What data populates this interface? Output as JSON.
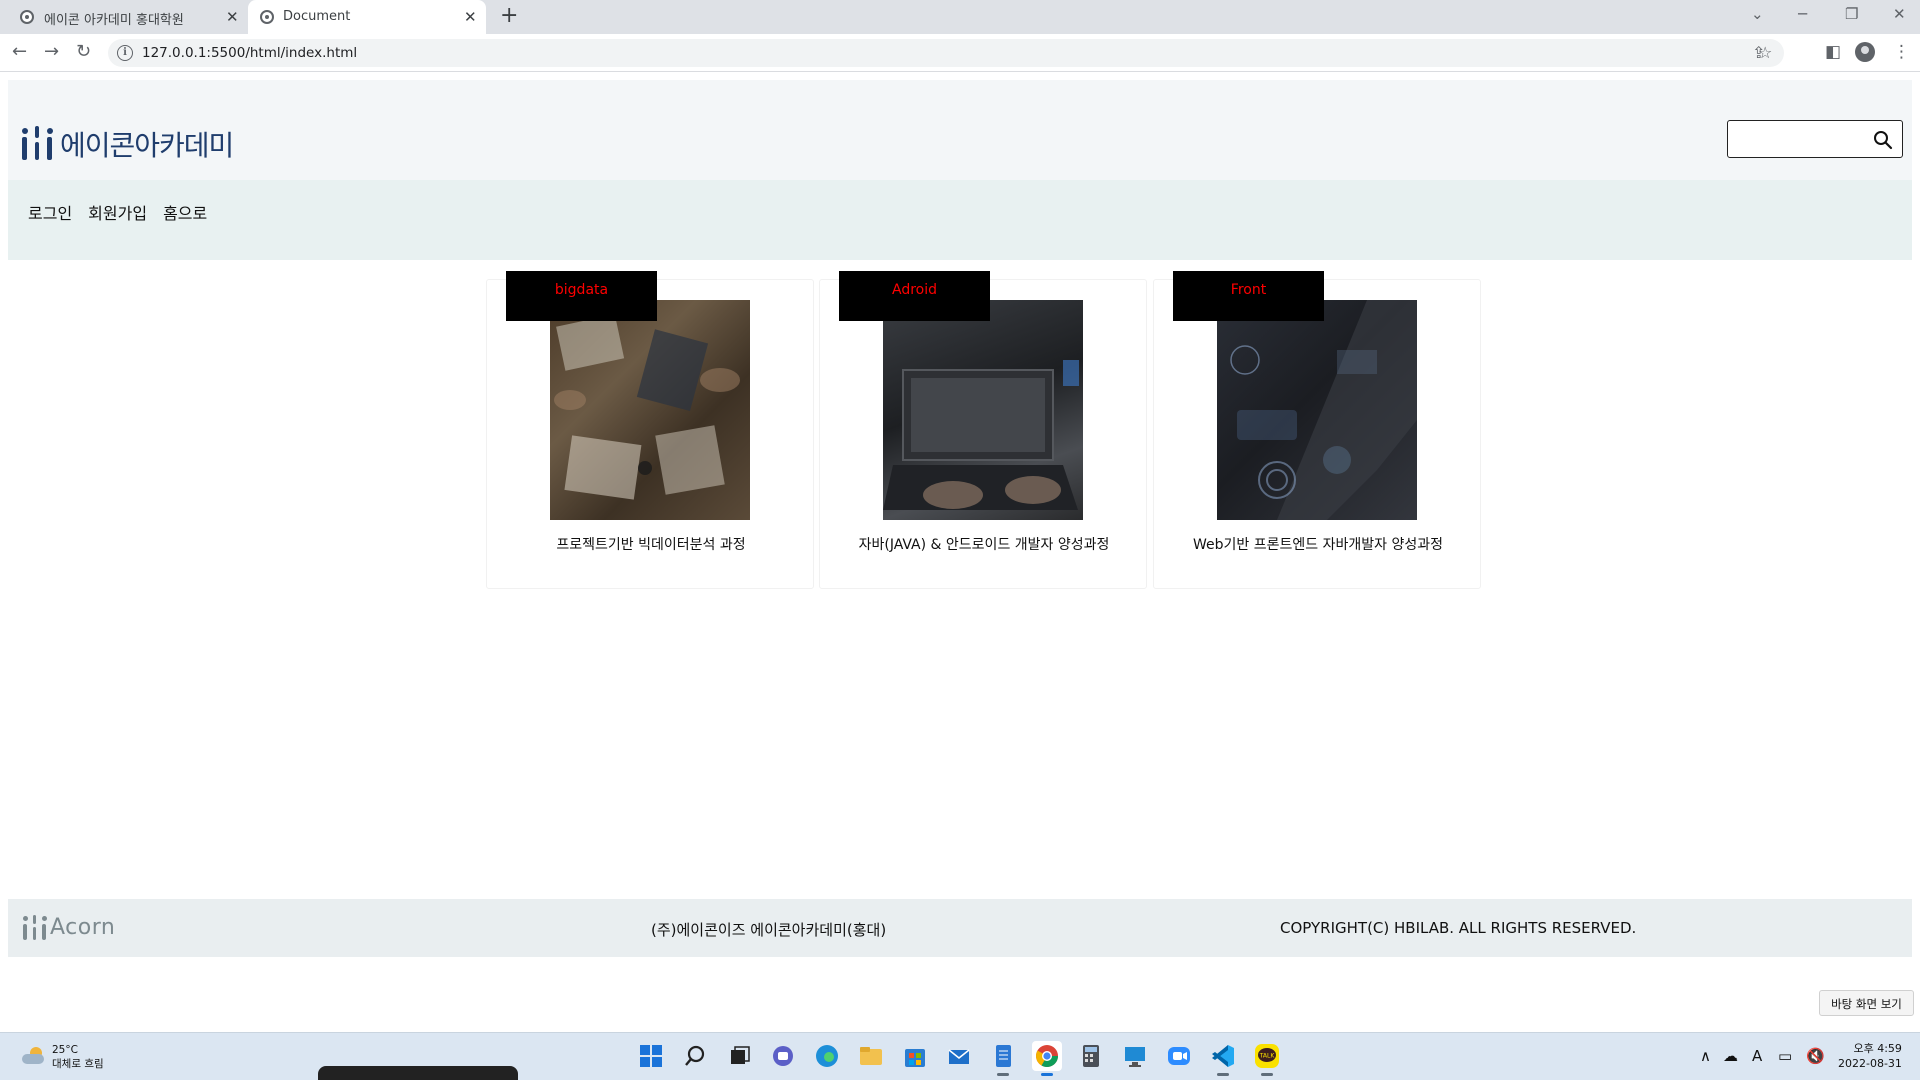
{
  "browser": {
    "tabs": [
      {
        "title": "에이콘 아카데미 홍대학원"
      },
      {
        "title": "Document"
      }
    ],
    "url": "127.0.0.1:5500/html/index.html"
  },
  "site": {
    "logo_text": "에이콘아카데미",
    "search": {
      "placeholder": "",
      "value": ""
    },
    "nav": [
      "로그인",
      "회원가입",
      "홈으로"
    ],
    "courses": [
      {
        "badge": "bigdata",
        "title": "프로젝트기반 빅데이터분석 과정"
      },
      {
        "badge": "Adroid",
        "title": "자바(JAVA) & 안드로이드 개발자 양성과정"
      },
      {
        "badge": "Front",
        "title": "Web기반 프론트엔드 자바개발자 양성과정"
      }
    ],
    "footer": {
      "logo_text": "Acorn",
      "company": "(주)에이콘이즈 에이콘아카데미(홍대)",
      "copyright": "COPYRIGHT(C) HBILAB. ALL RIGHTS RESERVED."
    },
    "badge_text_color": "#ff0000",
    "brand_color": "#1f3d6d"
  },
  "taskbar": {
    "weather": {
      "temp": "25°C",
      "desc": "대체로 흐림"
    },
    "clock": {
      "time": "오후 4:59",
      "date": "2022-08-31"
    },
    "desktop_tooltip": "바탕 화면 보기",
    "ime": "A"
  }
}
